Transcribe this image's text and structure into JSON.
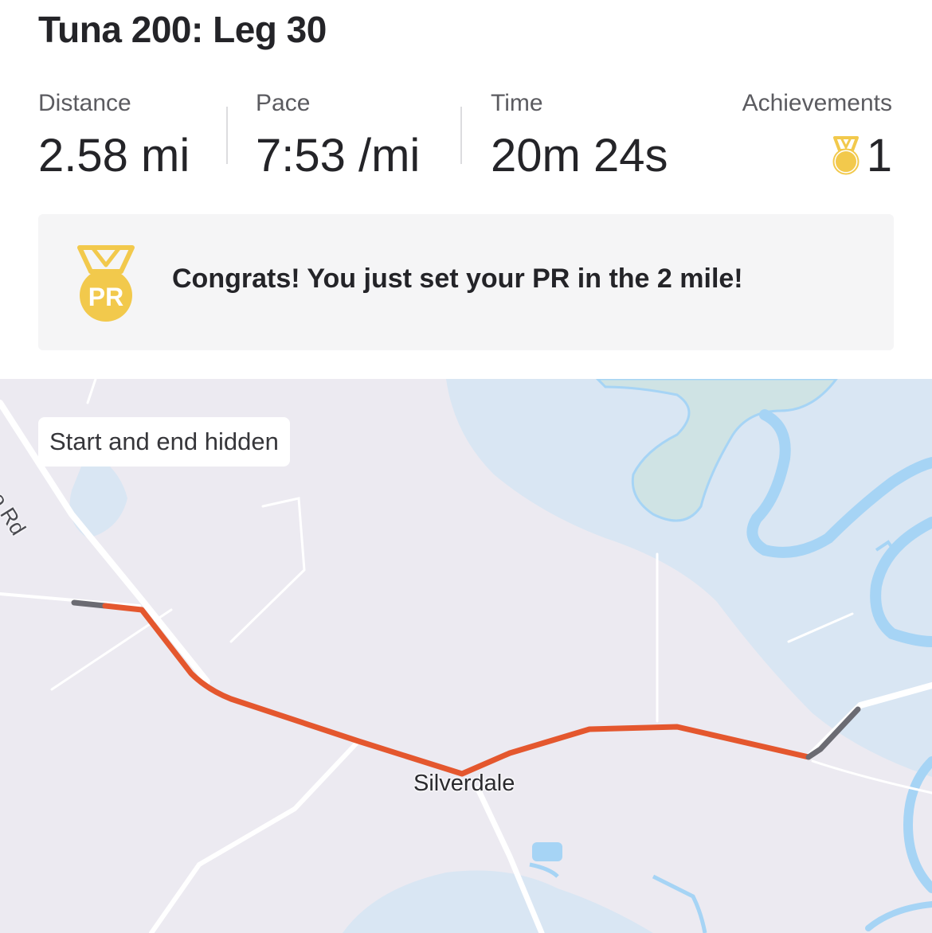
{
  "activity": {
    "title": "Tuna 200: Leg 30"
  },
  "stats": {
    "distance": {
      "label": "Distance",
      "value": "2.58 mi"
    },
    "pace": {
      "label": "Pace",
      "value": "7:53 /mi"
    },
    "time": {
      "label": "Time",
      "value": "20m 24s"
    },
    "achievements": {
      "label": "Achievements",
      "count": "1",
      "icon": "medal-icon"
    }
  },
  "banner": {
    "badge_text": "PR",
    "message": "Congrats! You just set your PR in the 2 mile!",
    "icon": "pr-medal-icon"
  },
  "map": {
    "privacy_label": "Start and end hidden",
    "town_label": "Silverdale",
    "road_label": "nsboro Rd",
    "route_color": "#e4572e",
    "hidden_segment_color": "#6b6b72",
    "water_color": "#a6d4f5",
    "land_color": "#eceaf1"
  },
  "colors": {
    "medal_gold": "#f2c94c",
    "text_primary": "#242428",
    "text_secondary": "#5b5b60"
  }
}
